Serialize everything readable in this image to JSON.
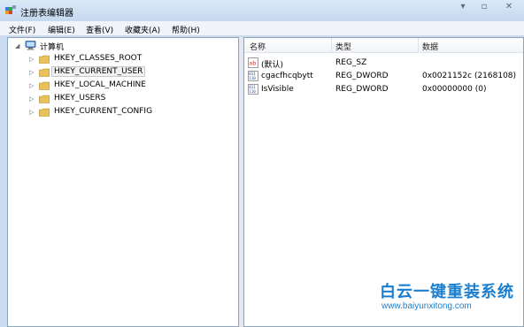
{
  "window": {
    "title": "注册表编辑器",
    "controls": {
      "minimize": "▾",
      "maximize": "▫",
      "close": "✕"
    }
  },
  "menu": [
    "文件(F)",
    "编辑(E)",
    "查看(V)",
    "收藏夹(A)",
    "帮助(H)"
  ],
  "tree": {
    "root": {
      "label": "计算机",
      "icon": "computer-icon",
      "expanded": true
    },
    "items": [
      {
        "label": "HKEY_CLASSES_ROOT",
        "icon": "folder-icon",
        "selected": false
      },
      {
        "label": "HKEY_CURRENT_USER",
        "icon": "folder-icon",
        "selected": true
      },
      {
        "label": "HKEY_LOCAL_MACHINE",
        "icon": "folder-icon",
        "selected": false
      },
      {
        "label": "HKEY_USERS",
        "icon": "folder-icon",
        "selected": false
      },
      {
        "label": "HKEY_CURRENT_CONFIG",
        "icon": "folder-icon",
        "selected": false
      }
    ]
  },
  "list": {
    "columns": [
      "名称",
      "类型",
      "数据"
    ],
    "rows": [
      {
        "name": "(默认)",
        "type": "REG_SZ",
        "data": "",
        "icon": "string-value-icon"
      },
      {
        "name": "cgacfhcqbytt",
        "type": "REG_DWORD",
        "data": "0x0021152c (2168108)",
        "icon": "binary-value-icon"
      },
      {
        "name": "IsVisible",
        "type": "REG_DWORD",
        "data": "0x00000000 (0)",
        "icon": "binary-value-icon"
      }
    ]
  },
  "watermark": {
    "name": "白云一键重装系统",
    "url": "www.baiyunxitong.com"
  },
  "colors": {
    "accent": "#1a7fd0",
    "folder": "#e8c15a",
    "selection": "#f2f2f2"
  }
}
